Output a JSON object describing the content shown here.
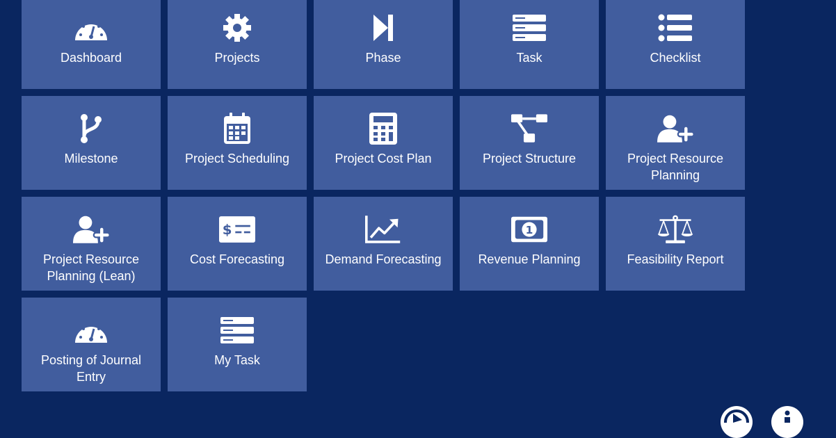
{
  "tiles": [
    {
      "label": "Dashboard",
      "icon": "dashboard-gauge-icon"
    },
    {
      "label": "Projects",
      "icon": "gear-icon"
    },
    {
      "label": "Phase",
      "icon": "skip-forward-icon"
    },
    {
      "label": "Task",
      "icon": "server-stack-icon"
    },
    {
      "label": "Checklist",
      "icon": "list-icon"
    },
    {
      "label": "Milestone",
      "icon": "code-branch-icon"
    },
    {
      "label": "Project Scheduling",
      "icon": "calendar-icon"
    },
    {
      "label": "Project Cost Plan",
      "icon": "calculator-icon"
    },
    {
      "label": "Project Structure",
      "icon": "sitemap-icon"
    },
    {
      "label": "Project Resource Planning",
      "icon": "user-plus-icon"
    },
    {
      "label": "Project Resource Planning (Lean)",
      "icon": "user-plus-icon"
    },
    {
      "label": "Cost Forecasting",
      "icon": "money-check-icon"
    },
    {
      "label": "Demand Forecasting",
      "icon": "chart-line-icon"
    },
    {
      "label": "Revenue Planning",
      "icon": "money-bill-icon"
    },
    {
      "label": "Feasibility Report",
      "icon": "balance-scale-icon"
    },
    {
      "label": "Posting of Journal Entry",
      "icon": "dashboard-gauge-icon"
    },
    {
      "label": "My Task",
      "icon": "server-stack-icon"
    }
  ],
  "corner_buttons": [
    {
      "icon": "play-circle-icon"
    },
    {
      "icon": "info-icon"
    }
  ],
  "colors": {
    "background": "#0a2660",
    "tile": "#415d9e",
    "text": "#ffffff"
  }
}
